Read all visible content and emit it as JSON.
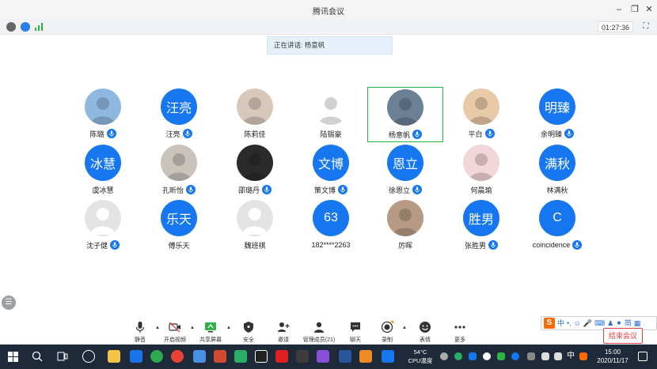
{
  "window": {
    "title": "腾讯会议"
  },
  "info": {
    "timer": "01:27:36"
  },
  "speaking": {
    "text": "正在讲话: 杨意帆"
  },
  "participants": [
    {
      "name": "陈璐",
      "avatar_text": "",
      "avatar_kind": "photo",
      "avatar_color": "#8fb8e0",
      "mic": true
    },
    {
      "name": "汪亮",
      "avatar_text": "汪亮",
      "avatar_kind": "blue",
      "mic": true
    },
    {
      "name": "陈莉佳",
      "avatar_text": "",
      "avatar_kind": "photo",
      "avatar_color": "#d8c8bc",
      "mic": false
    },
    {
      "name": "陆锡豪",
      "avatar_text": "",
      "avatar_kind": "photo",
      "avatar_color": "#ffffff",
      "mic": false
    },
    {
      "name": "杨意帆",
      "avatar_text": "",
      "avatar_kind": "photo",
      "avatar_color": "#6b7f95",
      "mic": true,
      "active": true
    },
    {
      "name": "平白",
      "avatar_text": "",
      "avatar_kind": "photo",
      "avatar_color": "#e8c9a8",
      "mic": true
    },
    {
      "name": "余明臻",
      "avatar_text": "明臻",
      "avatar_kind": "blue",
      "mic": true
    },
    {
      "name": "虞冰慧",
      "avatar_text": "冰慧",
      "avatar_kind": "blue",
      "mic": false
    },
    {
      "name": "孔昕怡",
      "avatar_text": "",
      "avatar_kind": "photo",
      "avatar_color": "#c9c3bb",
      "mic": true
    },
    {
      "name": "邵璐丹",
      "avatar_text": "",
      "avatar_kind": "photo",
      "avatar_color": "#2b2b2b",
      "mic": true
    },
    {
      "name": "策文博",
      "avatar_text": "文博",
      "avatar_kind": "blue",
      "mic": true
    },
    {
      "name": "徐恩立",
      "avatar_text": "恩立",
      "avatar_kind": "blue",
      "mic": true
    },
    {
      "name": "何晨瑜",
      "avatar_text": "",
      "avatar_kind": "photo",
      "avatar_color": "#f3d6da",
      "mic": false
    },
    {
      "name": "林满秋",
      "avatar_text": "满秋",
      "avatar_kind": "blue",
      "mic": false
    },
    {
      "name": "沈子健",
      "avatar_text": "",
      "avatar_kind": "grey",
      "mic": true
    },
    {
      "name": "傅乐天",
      "avatar_text": "乐天",
      "avatar_kind": "blue",
      "mic": false
    },
    {
      "name": "魏班祺",
      "avatar_text": "",
      "avatar_kind": "grey",
      "mic": false
    },
    {
      "name": "182****2263",
      "avatar_text": "63",
      "avatar_kind": "blue",
      "mic": false
    },
    {
      "name": "厉晖",
      "avatar_text": "",
      "avatar_kind": "photo",
      "avatar_color": "#b79a86",
      "mic": false
    },
    {
      "name": "张胜男",
      "avatar_text": "胜男",
      "avatar_kind": "blue",
      "mic": true
    },
    {
      "name": "coincidence",
      "avatar_text": "C",
      "avatar_kind": "blue",
      "mic": true
    }
  ],
  "toolbar": {
    "mute": "静音",
    "video": "开启视频",
    "share": "共享屏幕",
    "security": "安全",
    "invite": "邀请",
    "members": "管理成员(21)",
    "chat": "聊天",
    "record": "录制",
    "emoji": "表情",
    "more": "更多",
    "end": "结束会议"
  },
  "ime": {
    "lang": "中",
    "mode": "简"
  },
  "taskbar": {
    "cpu_temp": "54°C",
    "cpu_label": "CPU温度",
    "tray_lang": "中",
    "time": "15:00",
    "date": "2020/11/17"
  },
  "colors": {
    "accent": "#1677f0",
    "active_border": "#2fb344",
    "end_red": "#e04040",
    "taskbar": "#1e2a3a"
  }
}
